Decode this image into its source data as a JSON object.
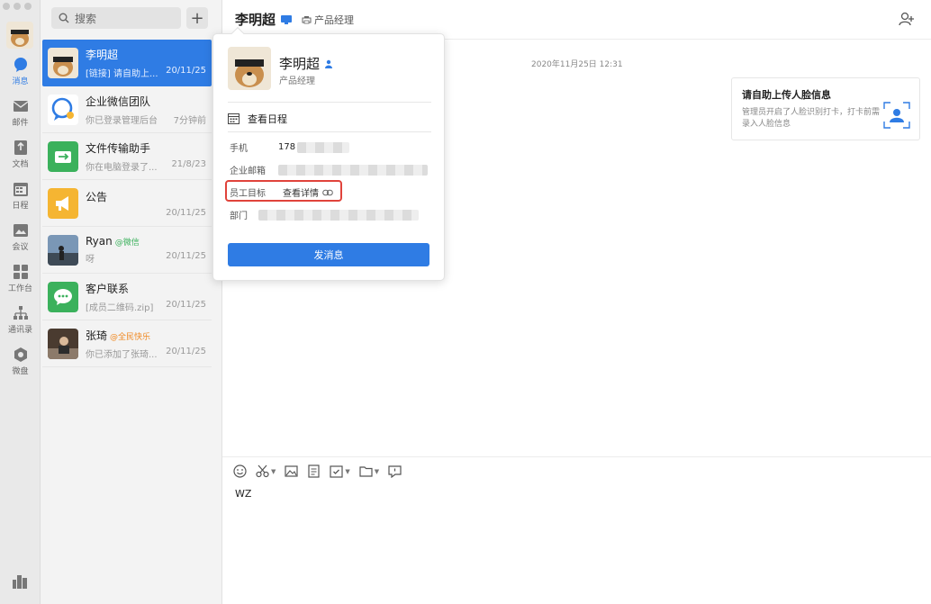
{
  "nav": {
    "items": [
      {
        "label": "消息",
        "icon": "chat-bubble-icon",
        "active": true
      },
      {
        "label": "邮件",
        "icon": "mail-icon"
      },
      {
        "label": "文档",
        "icon": "document-icon"
      },
      {
        "label": "日程",
        "icon": "calendar-icon"
      },
      {
        "label": "会议",
        "icon": "meeting-icon"
      },
      {
        "label": "工作台",
        "icon": "workbench-grid-icon"
      },
      {
        "label": "通讯录",
        "icon": "contacts-icon"
      },
      {
        "label": "微盘",
        "icon": "drive-icon"
      }
    ],
    "bottom_icon": "app-logo-icon"
  },
  "list": {
    "search_placeholder": "搜索",
    "add_label": "+",
    "conversations": [
      {
        "name": "李明超",
        "preview": "[链接] 请自助上...",
        "time": "20/11/25",
        "active": true
      },
      {
        "name": "企业微信团队",
        "preview": "你已登录管理后台",
        "time": "7分钟前"
      },
      {
        "name": "文件传输助手",
        "preview": "你在电脑登录了...",
        "time": "21/8/23"
      },
      {
        "name": "公告",
        "preview": "",
        "time": "20/11/25"
      },
      {
        "name": "Ryan",
        "tag": "@微信",
        "preview": "呀",
        "time": "20/11/25"
      },
      {
        "name": "客户联系",
        "preview": "[成员二维码.zip]",
        "time": "20/11/25"
      },
      {
        "name": "张琦",
        "tag": "@全民快乐",
        "preview": "你已添加了张琦...",
        "time": "20/11/25"
      }
    ]
  },
  "header": {
    "title": "李明超",
    "position": "产品经理"
  },
  "chat": {
    "timestamp": "2020年11月25日 12:31",
    "card_title": "请自助上传人脸信息",
    "card_desc": "管理员开启了人脸识别打卡，打卡前需录入人脸信息"
  },
  "composer": {
    "draft": "WZ"
  },
  "popup": {
    "name": "李明超",
    "role": "产品经理",
    "schedule_label": "查看日程",
    "phone_label": "手机",
    "phone_value": "178",
    "email_label": "企业邮箱",
    "goal_label": "员工目标",
    "goal_link": "查看详情",
    "dept_label": "部门",
    "send_label": "发消息"
  },
  "colors": {
    "accent": "#2f7ce4",
    "highlight": "#e0433b"
  }
}
